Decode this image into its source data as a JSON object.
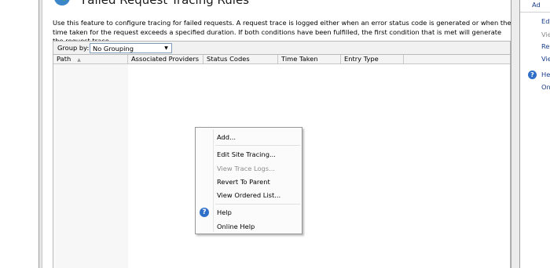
{
  "feature": {
    "title": "Failed Request Tracing Rules",
    "description": "Use this feature to configure tracing for failed requests. A request trace is logged either when an error status code is generated or when the time taken for the request exceeds a specified duration. If both conditions have been fulfilled, the first condition that is met will generate the request trace."
  },
  "toolbar": {
    "group_by_label": "Group by:",
    "group_by_value": "No Grouping"
  },
  "grid": {
    "columns": [
      "Path",
      "Associated Providers",
      "Status Codes",
      "Time Taken",
      "Entry Type"
    ],
    "sort_indicator": "▲"
  },
  "context_menu": {
    "items": [
      {
        "label": "Add...",
        "enabled": true
      },
      {
        "label": "Edit Site Tracing...",
        "enabled": true
      },
      {
        "label": "View Trace Logs...",
        "enabled": false
      },
      {
        "label": "Revert To Parent",
        "enabled": true
      },
      {
        "label": "View Ordered List...",
        "enabled": true
      },
      {
        "label": "Help",
        "enabled": true,
        "icon": "help-icon"
      },
      {
        "label": "Online Help",
        "enabled": true
      }
    ]
  },
  "actions_pane": {
    "items": [
      "Ad",
      "Edi",
      "Vie",
      "Re",
      "Vie",
      "He",
      "On"
    ]
  },
  "colors": {
    "link": "#1a3e8a",
    "disabled": "#8d8d8d",
    "help_icon": "#2f6fc9"
  }
}
